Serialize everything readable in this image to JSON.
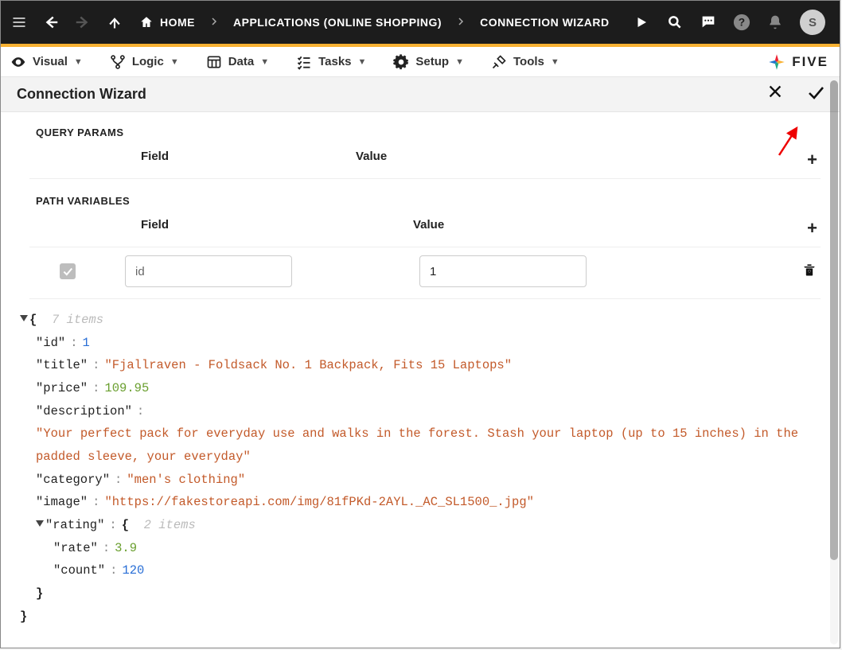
{
  "topbar": {
    "crumbs": {
      "home": "HOME",
      "apps": "APPLICATIONS (ONLINE SHOPPING)",
      "wizard": "CONNECTION WIZARD"
    },
    "avatar_initial": "S"
  },
  "toolbar": {
    "visual": "Visual",
    "logic": "Logic",
    "data": "Data",
    "tasks": "Tasks",
    "setup": "Setup",
    "tools": "Tools",
    "brand": "FIVE"
  },
  "page": {
    "title": "Connection Wizard"
  },
  "sections": {
    "query_params": {
      "label": "QUERY PARAMS",
      "field_header": "Field",
      "value_header": "Value"
    },
    "path_vars": {
      "label": "PATH VARIABLES",
      "field_header": "Field",
      "value_header": "Value",
      "rows": [
        {
          "field": "id",
          "value": "1"
        }
      ]
    }
  },
  "json_preview": {
    "root_meta": "7 items",
    "kv": {
      "id": 1,
      "title": "Fjallraven - Foldsack No. 1 Backpack, Fits 15 Laptops",
      "price": 109.95,
      "description": "Your perfect pack for everyday use and walks in the forest. Stash your laptop (up to 15 inches) in the padded sleeve, your everyday",
      "category": "men's clothing",
      "image": "https://fakestoreapi.com/img/81fPKd-2AYL._AC_SL1500_.jpg"
    },
    "rating_meta": "2 items",
    "rating": {
      "rate": 3.9,
      "count": 120
    }
  }
}
